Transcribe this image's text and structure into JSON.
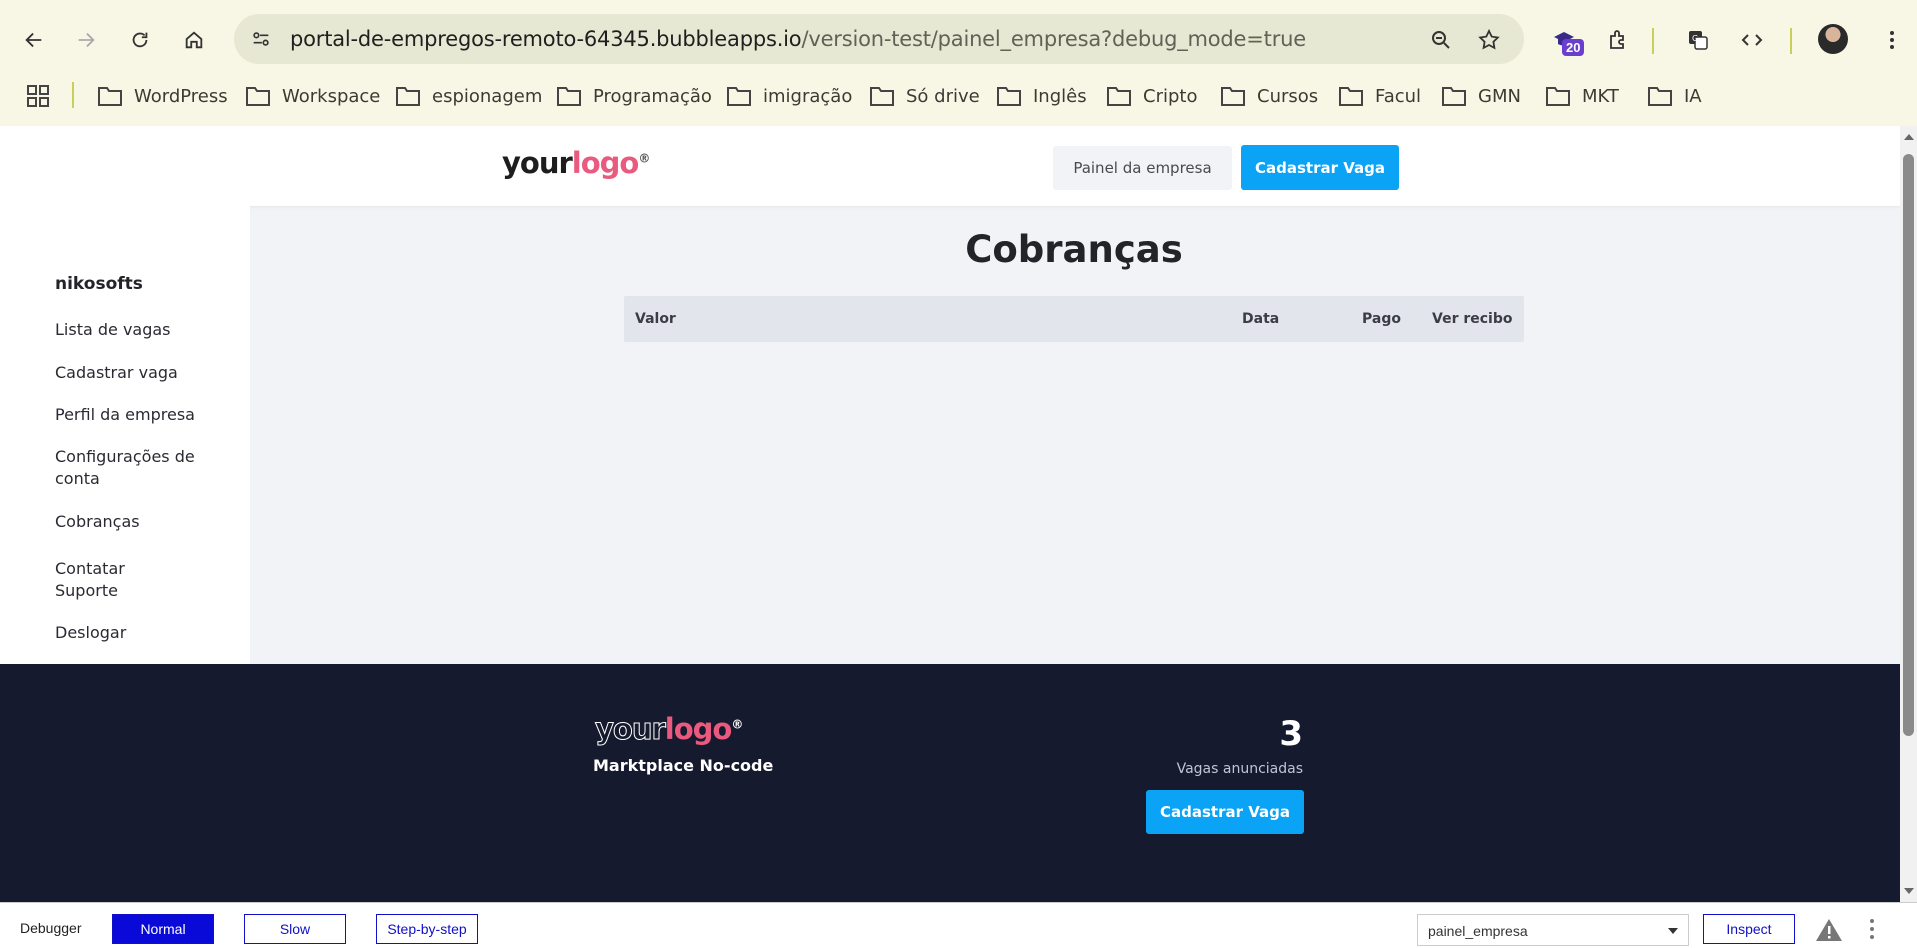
{
  "browser": {
    "url_main": "portal-de-empregos-remoto-64345.bubbleapps.io",
    "url_path": "/version-test/painel_empresa?debug_mode=true",
    "extension_badge": "20",
    "bookmarks": [
      "WordPress",
      "Workspace",
      "espionagem",
      "Programação",
      "imigração",
      "Só drive",
      "Inglês",
      "Cripto",
      "Cursos",
      "Facul",
      "GMN",
      "MKT",
      "IA"
    ]
  },
  "header": {
    "logo_your": "your",
    "logo_logo": "logo",
    "logo_reg": "®",
    "panel_button": "Painel da empresa",
    "register_button": "Cadastrar Vaga"
  },
  "sidebar": {
    "company": "nikosofts",
    "items": [
      {
        "label": "Lista de vagas"
      },
      {
        "label": "Cadastrar vaga"
      },
      {
        "label": "Perfil da empresa"
      },
      {
        "label": "Configurações de conta"
      },
      {
        "label": "Cobranças"
      },
      {
        "label": "Contatar Suporte"
      },
      {
        "label": "Deslogar"
      }
    ]
  },
  "main": {
    "title": "Cobranças",
    "columns": [
      "Valor",
      "Data",
      "Pago",
      "Ver recibo"
    ]
  },
  "footer": {
    "tagline": "Marktplace No-code",
    "count": "3",
    "count_label": "Vagas anunciadas",
    "register_button": "Cadastrar Vaga"
  },
  "debugger": {
    "label": "Debugger",
    "modes": [
      "Normal",
      "Slow",
      "Step-by-step"
    ],
    "active_mode": "Normal",
    "page_select": "painel_empresa",
    "inspect_button": "Inspect"
  },
  "colors": {
    "accent": "#0aa3f5",
    "footer_bg": "#161a2e",
    "logo_pink": "#ea5a7f",
    "debugger_blue": "#1010c8"
  }
}
